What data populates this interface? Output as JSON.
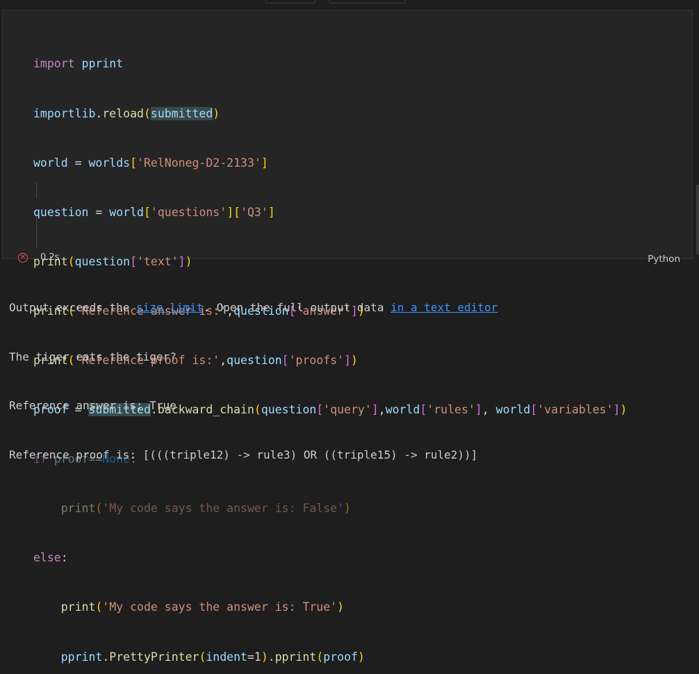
{
  "cell": {
    "code_lines": [
      "import pprint",
      "importlib.reload(submitted)",
      "world = worlds['RelNoneg-D2-2133']",
      "question = world['questions']['Q3']",
      "print(question['text'])",
      "print('Reference answer is:',question['answer'])",
      "print('Reference proof is:',question['proofs'])",
      "proof = submitted.backward_chain(question['query'],world['rules'], world['variables'])",
      "if proof==None:",
      "    print('My code says the answer is: False')",
      "else:",
      "    print('My code says the answer is: True')",
      "    pprint.PrettyPrinter(indent=1).pprint(proof)"
    ],
    "status_icon": "error-circle-icon",
    "status_color": "#f14c4c",
    "duration": "0.2s",
    "language": "Python"
  },
  "output": {
    "notice_prefix": "Output exceeds the ",
    "size_limit_link": "size limit",
    "notice_middle": ". Open the full output data ",
    "text_editor_link": "in a text editor",
    "lines": [
      "The tiger eats the tiger?",
      "Reference answer is: True",
      "Reference proof is: [(((triple12) -> rule3) OR ((triple15) -> rule2))]"
    ]
  },
  "colors": {
    "background": "#1e1e1e",
    "cell_background": "#252526",
    "link": "#3794ff"
  }
}
